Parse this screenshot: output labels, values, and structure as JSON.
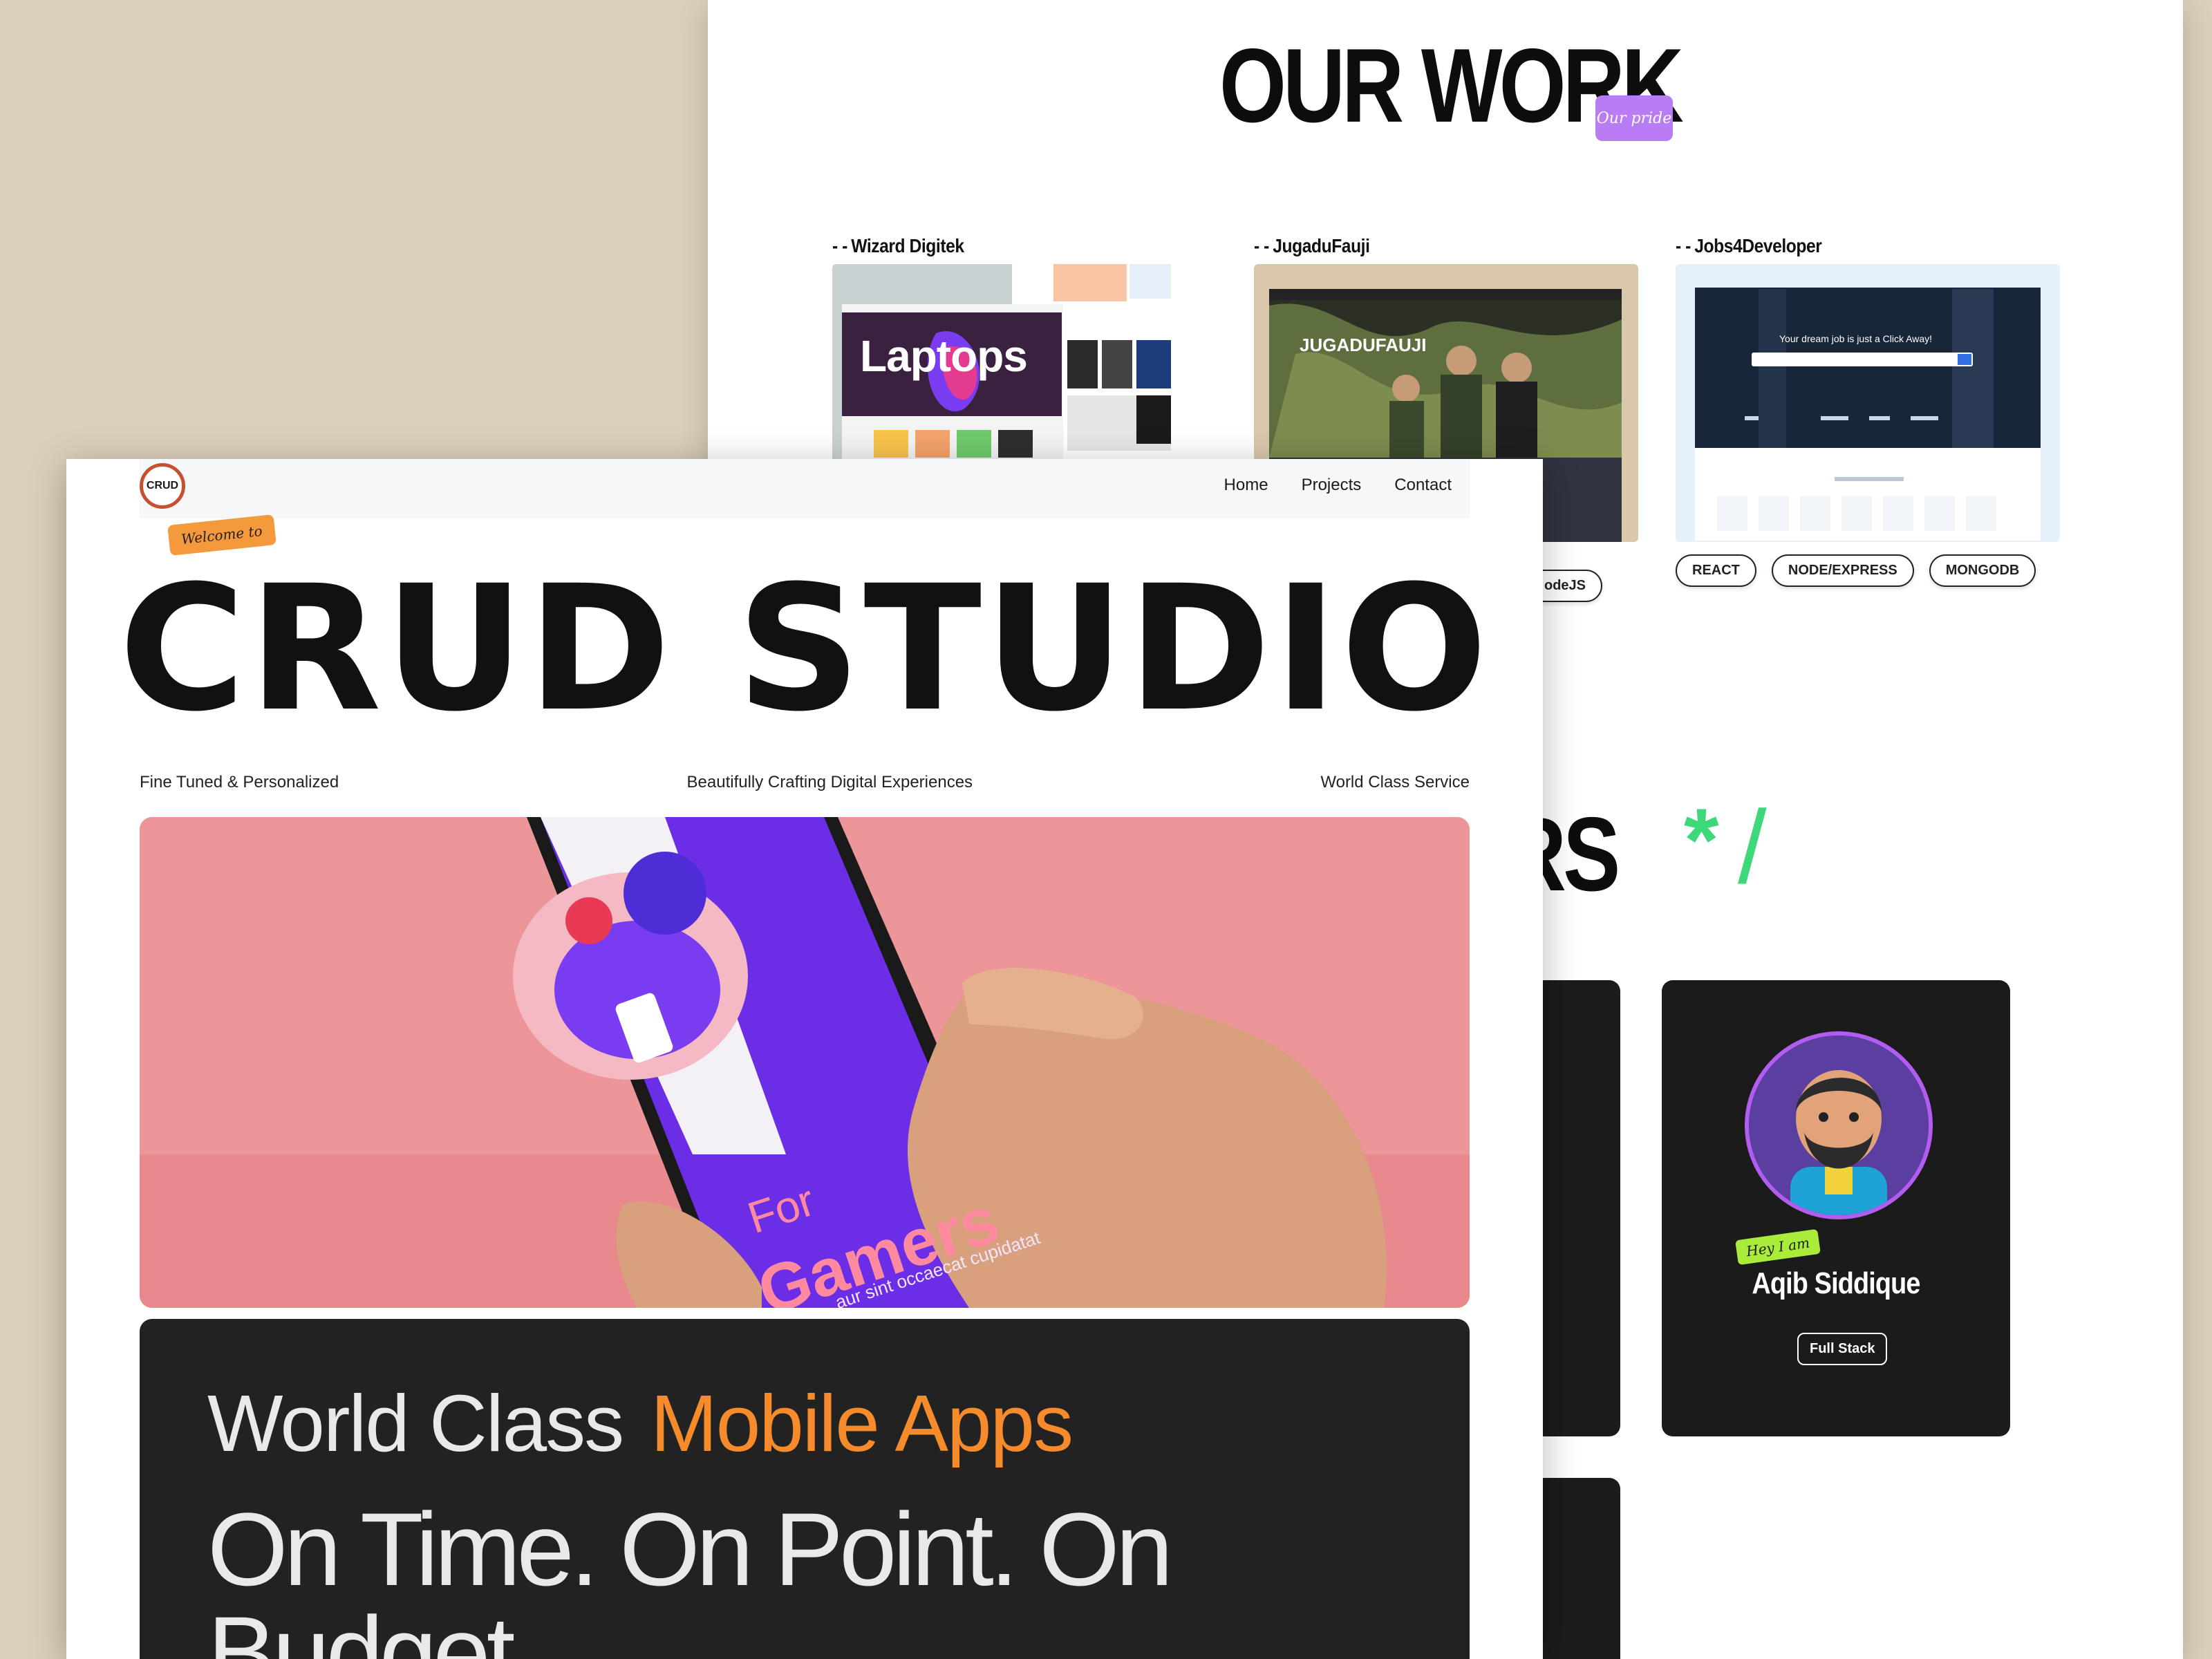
{
  "back": {
    "section_title": "OUR WORK",
    "section_tag": "Our pride",
    "projects": [
      {
        "name": "Wizard Digitek",
        "thumb_text": "Laptops",
        "tags": []
      },
      {
        "name": "JugaduFauji",
        "thumb_text": "JUGADUFAUJI",
        "tags": [
          "odeJS"
        ]
      },
      {
        "name": "Jobs4Developer",
        "thumb_text": "Your dream job is just a Click Away!",
        "tags": [
          "REACT",
          "NODE/EXPRESS",
          "MONGODB"
        ]
      }
    ],
    "creators_heading_visible": "ORS",
    "creators_asterisk": "*",
    "creators_slash": "/",
    "profile": {
      "hey_tag": "Hey I am",
      "name": "Aqib Siddique",
      "role": "Full Stack"
    },
    "project_dash": "- -"
  },
  "front": {
    "logo_text": "CRUD",
    "nav": [
      "Home",
      "Projects",
      "Contact"
    ],
    "welcome_tag": "Welcome to",
    "hero_title": "CRUD STUDIO",
    "subtitles": [
      "Fine Tuned & Personalized",
      "Beautifully Crafting Digital Experiences",
      "World Class Service"
    ],
    "image_text": {
      "line1": "For",
      "line2": "Gamers",
      "small": "aur sint occaecat cupidatat"
    },
    "panel": {
      "line1_plain": "World Class",
      "line1_accent": "Mobile Apps",
      "line2": "On Time. On Point. On Budget"
    }
  },
  "colors": {
    "page_bg": "#dccfba",
    "accent_orange": "#f68b2c",
    "accent_purple": "#b97cf2",
    "accent_green": "#3ed87a",
    "dark": "#1b1b1b"
  }
}
